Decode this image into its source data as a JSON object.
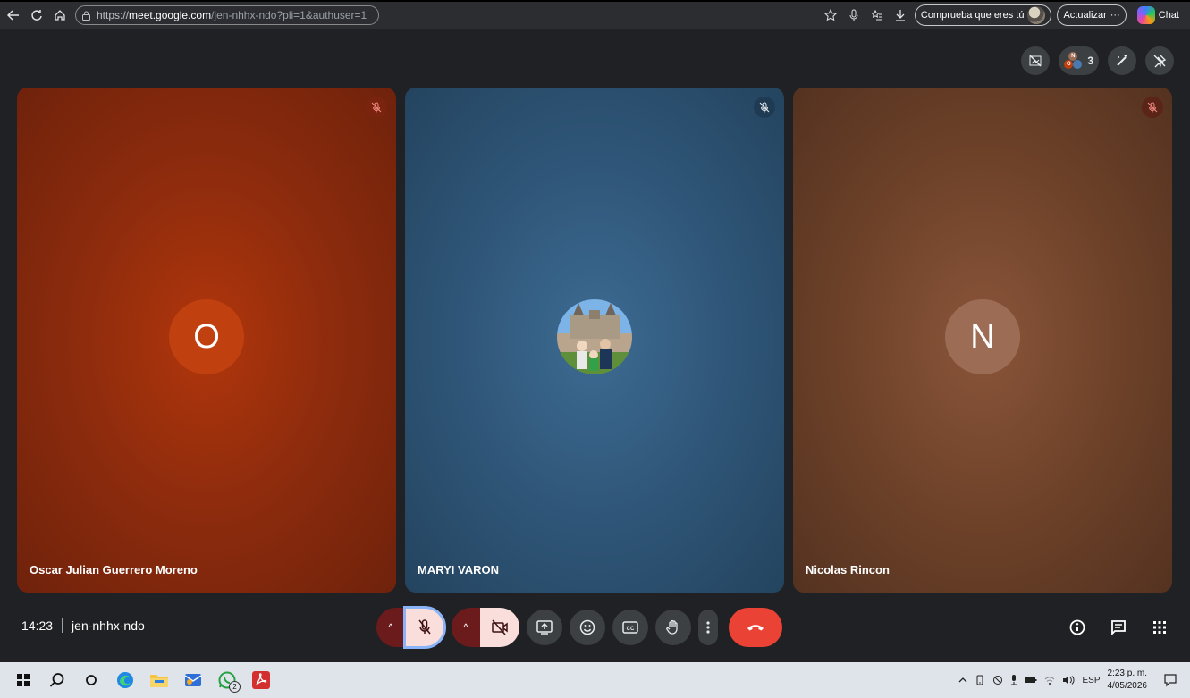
{
  "browser": {
    "url_host": "meet.google.com",
    "url_prefix": "https://",
    "url_path": "/jen-nhhx-ndo?pli=1&authuser=1",
    "verify_label": "Comprueba que eres tú",
    "update_label": "Actualizar",
    "chat_label": "Chat"
  },
  "top_controls": {
    "participant_count": "3",
    "mini_avatar_letters": [
      "N",
      "O"
    ]
  },
  "tiles": [
    {
      "name": "Oscar Julian Guerrero Moreno",
      "initial": "O",
      "muted": true
    },
    {
      "name": "MARYI VARON",
      "initial": "",
      "muted": true,
      "has_photo": true
    },
    {
      "name": "Nicolas Rincon",
      "initial": "N",
      "muted": true
    }
  ],
  "meeting": {
    "time": "14:23",
    "code": "jen-nhhx-ndo"
  },
  "taskbar": {
    "whatsapp_badge": "2",
    "language": "ESP",
    "time": "2:23 p. m.",
    "date": "4/05/2026"
  },
  "colors": {
    "end_call": "#ea4335",
    "mic_off_bg": "#f9dedc",
    "accent_outline": "#8ab4f8"
  }
}
